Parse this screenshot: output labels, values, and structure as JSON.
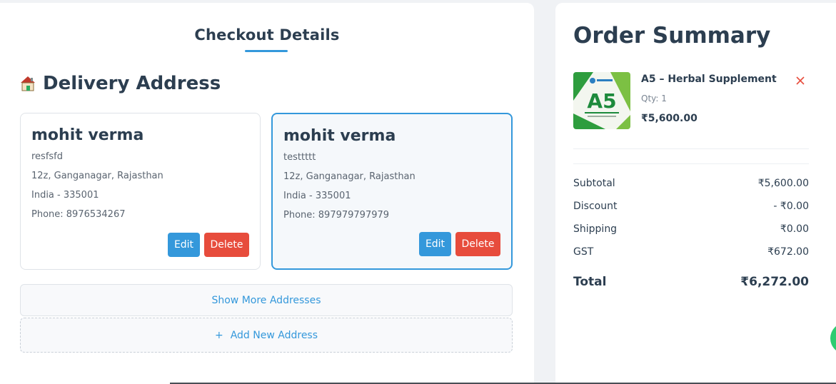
{
  "checkout": {
    "title": "Checkout Details",
    "section_heading": "Delivery Address",
    "addresses": [
      {
        "name": "mohit verma",
        "line1": "resfsfd",
        "line2": "12z, Ganganagar, Rajasthan",
        "line3": "India - 335001",
        "phone": "Phone: 8976534267",
        "selected": false
      },
      {
        "name": "mohit verma",
        "line1": "testtttt",
        "line2": "12z, Ganganagar, Rajasthan",
        "line3": "India - 335001",
        "phone": "Phone: 897979797979",
        "selected": true
      }
    ],
    "edit_label": "Edit",
    "delete_label": "Delete",
    "show_more_label": "Show More Addresses",
    "add_new_plus": "+",
    "add_new_label": "Add New Address"
  },
  "summary": {
    "title": "Order Summary",
    "item": {
      "name": "A5 – Herbal Supplement",
      "qty": "Qty: 1",
      "price": "₹5,600.00",
      "thumb_text": "A5"
    },
    "rows": [
      {
        "label": "Subtotal",
        "value": "₹5,600.00"
      },
      {
        "label": "Discount",
        "value": "- ₹0.00"
      },
      {
        "label": "Shipping",
        "value": "₹0.00"
      },
      {
        "label": "GST",
        "value": "₹672.00"
      }
    ],
    "total_label": "Total",
    "total_value": "₹6,272.00"
  },
  "colors": {
    "accent": "#3498db",
    "danger": "#e74c3c",
    "text": "#2c3e50",
    "fab": "#2ecc71"
  },
  "icons": {
    "home": "home-icon",
    "remove": "close-icon"
  }
}
